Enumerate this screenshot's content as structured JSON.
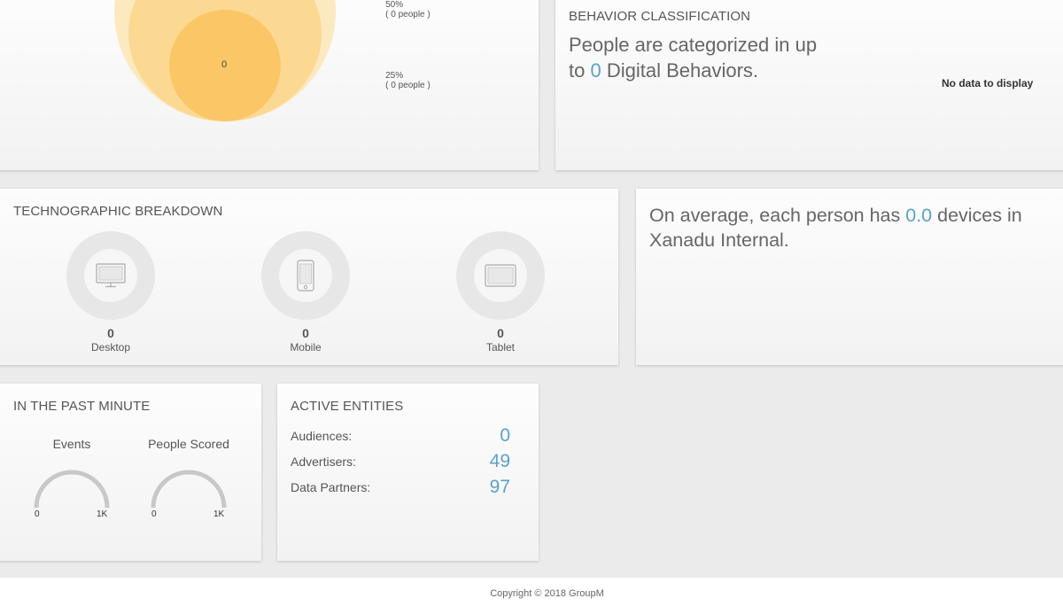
{
  "funnel": {
    "rows": [
      {
        "percent": "50%",
        "people": "( 0 people )"
      },
      {
        "percent": "25%",
        "people": "( 0 people )"
      }
    ],
    "bubble_value": "0",
    "colors": {
      "outer": "#fde7b8",
      "mid": "#fcd98f",
      "inner": "#fbc45f"
    }
  },
  "behavior": {
    "title": "BEHAVIOR CLASSIFICATION",
    "line1": "People are categorized in up",
    "line2_prefix": "to ",
    "count": "0",
    "line2_suffix": " Digital Behaviors.",
    "no_data": "No data to display"
  },
  "technographic": {
    "title": "TECHNOGRAPHIC BREAKDOWN",
    "devices": [
      {
        "icon": "desktop-icon",
        "value": "0",
        "label": "Desktop"
      },
      {
        "icon": "mobile-icon",
        "value": "0",
        "label": "Mobile"
      },
      {
        "icon": "tablet-icon",
        "value": "0",
        "label": "Tablet"
      }
    ]
  },
  "average": {
    "prefix": "On average, each person has ",
    "value": "0.0",
    "suffix": " devices in",
    "line2": "Xanadu Internal."
  },
  "past_minute": {
    "title": "IN THE PAST MINUTE",
    "gauges": [
      {
        "label": "Events",
        "min": "0",
        "max": "1K",
        "value": 0
      },
      {
        "label": "People Scored",
        "min": "0",
        "max": "1K",
        "value": 0
      }
    ]
  },
  "entities": {
    "title": "ACTIVE ENTITIES",
    "rows": [
      {
        "label": "Audiences:",
        "value": "0"
      },
      {
        "label": "Advertisers:",
        "value": "49"
      },
      {
        "label": "Data Partners:",
        "value": "97"
      }
    ]
  },
  "footer": {
    "copyright": "Copyright © 2018 GroupM"
  },
  "colors": {
    "accent": "#5aa2c8",
    "background": "#ecebeb"
  }
}
